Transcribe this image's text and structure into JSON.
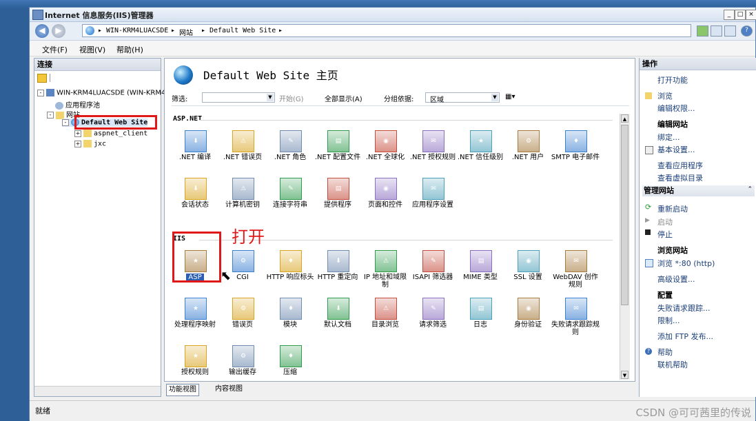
{
  "window": {
    "title": "Internet 信息服务(IIS)管理器",
    "min": "_",
    "max": "□",
    "close": "×"
  },
  "address": {
    "crumbs": [
      "WIN-KRM4LUACSDE",
      "网站",
      "Default Web Site"
    ]
  },
  "menu": [
    "文件(F)",
    "视图(V)",
    "帮助(H)"
  ],
  "connections": {
    "title": "连接",
    "tree": [
      {
        "label": "WIN-KRM4LUACSDE (WIN-KRM4L",
        "sign": "-"
      },
      {
        "label": "应用程序池",
        "sign": ""
      },
      {
        "label": "网站",
        "sign": "-"
      },
      {
        "label": "Default Web Site",
        "sign": "-"
      },
      {
        "label": "aspnet_client",
        "sign": "+"
      },
      {
        "label": "jxc",
        "sign": "+"
      }
    ]
  },
  "main": {
    "page_title": "Default Web Site 主页",
    "filter": {
      "label": "筛选:",
      "go": "开始(G)",
      "show_all": "全部显示(A)",
      "group_by": "分组依据:",
      "group_value": "区域"
    },
    "groups": [
      {
        "name": "ASP.NET",
        "features": [
          ".NET 编译",
          ".NET 错误页",
          ".NET 角色",
          ".NET 配置文件",
          ".NET 全球化",
          ".NET 授权规则",
          ".NET 信任级别",
          ".NET 用户",
          "SMTP 电子邮件",
          "会话状态",
          "计算机密钥",
          "连接字符串",
          "提供程序",
          "页面和控件",
          "应用程序设置"
        ]
      },
      {
        "name": "IIS",
        "features": [
          "ASP",
          "CGI",
          "HTTP 响应标头",
          "HTTP 重定向",
          "IP 地址和域限制",
          "ISAPI 筛选器",
          "MIME 类型",
          "SSL 设置",
          "WebDAV 创作规则",
          "处理程序映射",
          "错误页",
          "模块",
          "默认文档",
          "目录浏览",
          "请求筛选",
          "日志",
          "身份验证",
          "失败请求跟踪规则",
          "授权规则",
          "输出缓存",
          "压缩"
        ]
      }
    ],
    "view_tabs": [
      "功能视图",
      "内容视图"
    ]
  },
  "actions": {
    "title": "操作",
    "items1": [
      "打开功能",
      "浏览",
      "编辑权限..."
    ],
    "edit_site": {
      "heading": "编辑网站",
      "items": [
        "绑定...",
        "基本设置...",
        "查看应用程序",
        "查看虚拟目录"
      ]
    },
    "manage": {
      "heading": "管理网站",
      "items": [
        "重新启动",
        "启动",
        "停止"
      ]
    },
    "browse": {
      "heading": "浏览网站",
      "items": [
        "浏览 *:80 (http)",
        "高级设置..."
      ]
    },
    "config": {
      "heading": "配置",
      "items": [
        "失败请求跟踪...",
        "限制..."
      ]
    },
    "ftp": "添加 FTP 发布...",
    "help": [
      "帮助",
      "联机帮助"
    ]
  },
  "status": {
    "text": "就绪"
  },
  "annotation": {
    "text": "打开"
  },
  "watermark": "CSDN @可可茜里的传说",
  "colors": {
    "highlight": "#e01818",
    "link": "#1c3f7a"
  }
}
